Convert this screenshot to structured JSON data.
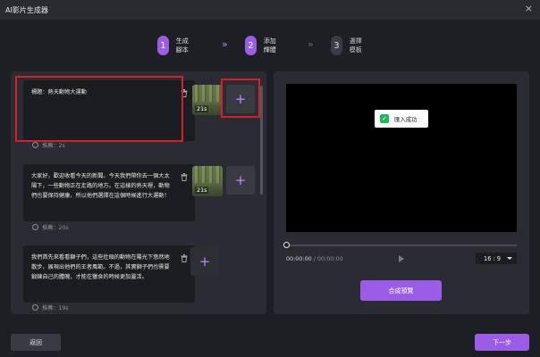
{
  "window": {
    "title": "AI影片生成器",
    "close_label": "×"
  },
  "steps": [
    {
      "number": "1",
      "label": "生成腳本"
    },
    {
      "number": "2",
      "label": "添加輝體"
    },
    {
      "number": "3",
      "label": "選擇模板"
    }
  ],
  "step_separator": "»",
  "cards": [
    {
      "text": "標題：熱天動物大運動",
      "duration": "推薦：2s",
      "thumb_duration": "21s"
    },
    {
      "text": "大家好，歡迎收看今天的新聞。今天我們帶你去一個大太陽下，一些動物正在走路的地方。在這樣的熱天裡，動物們也要保持健康，所以他們選擇在這個時候進行大運動！",
      "duration": "推薦：20s",
      "thumb_duration": "21s"
    },
    {
      "text": "我們首先來看看獅子們，這些壯碩的動物在陽光下悠然地散步，展現出他們的王者風範。不過，其實獅子們也需要鍛鍊自己的體魄，才能在獵食的時候更加靈活。",
      "duration": "推薦：19s"
    }
  ],
  "add_button_label": "+",
  "preview": {
    "toast_message": "匯入成功",
    "toast_check": "✓",
    "current_time": "00:00:00",
    "total_time": "/ 00:00:00",
    "aspect_ratio": "16 : 9",
    "compose_label": "合成預覽"
  },
  "footer": {
    "back_label": "返回",
    "next_label": "下一步"
  },
  "colors": {
    "accent": "#9b5de5",
    "highlight": "#d4202a",
    "success": "#22b55a"
  }
}
